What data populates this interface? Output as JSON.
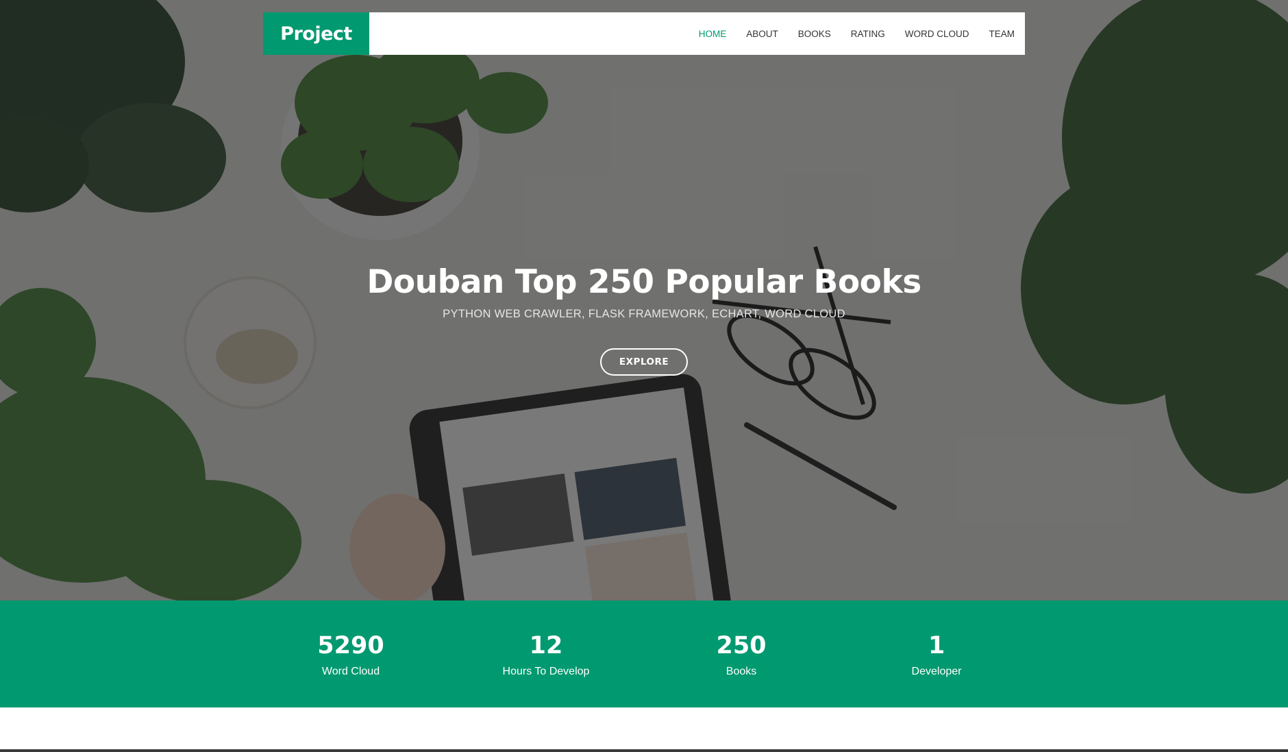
{
  "brand": {
    "name": "Project",
    "color": "#009970"
  },
  "nav": {
    "items": [
      {
        "label": "HOME",
        "active": true
      },
      {
        "label": "ABOUT",
        "active": false
      },
      {
        "label": "BOOKS",
        "active": false
      },
      {
        "label": "RATING",
        "active": false
      },
      {
        "label": "WORD CLOUD",
        "active": false
      },
      {
        "label": "TEAM",
        "active": false
      }
    ]
  },
  "hero": {
    "title": "Douban Top 250 Popular Books",
    "subtitle": "PYTHON WEB CRAWLER, FLASK FRAMEWORK, ECHART, WORD CLOUD",
    "button_label": "EXPLORE"
  },
  "stats": [
    {
      "number": "5290",
      "label": "Word Cloud"
    },
    {
      "number": "12",
      "label": "Hours To Develop"
    },
    {
      "number": "250",
      "label": "Books"
    },
    {
      "number": "1",
      "label": "Developer"
    }
  ]
}
